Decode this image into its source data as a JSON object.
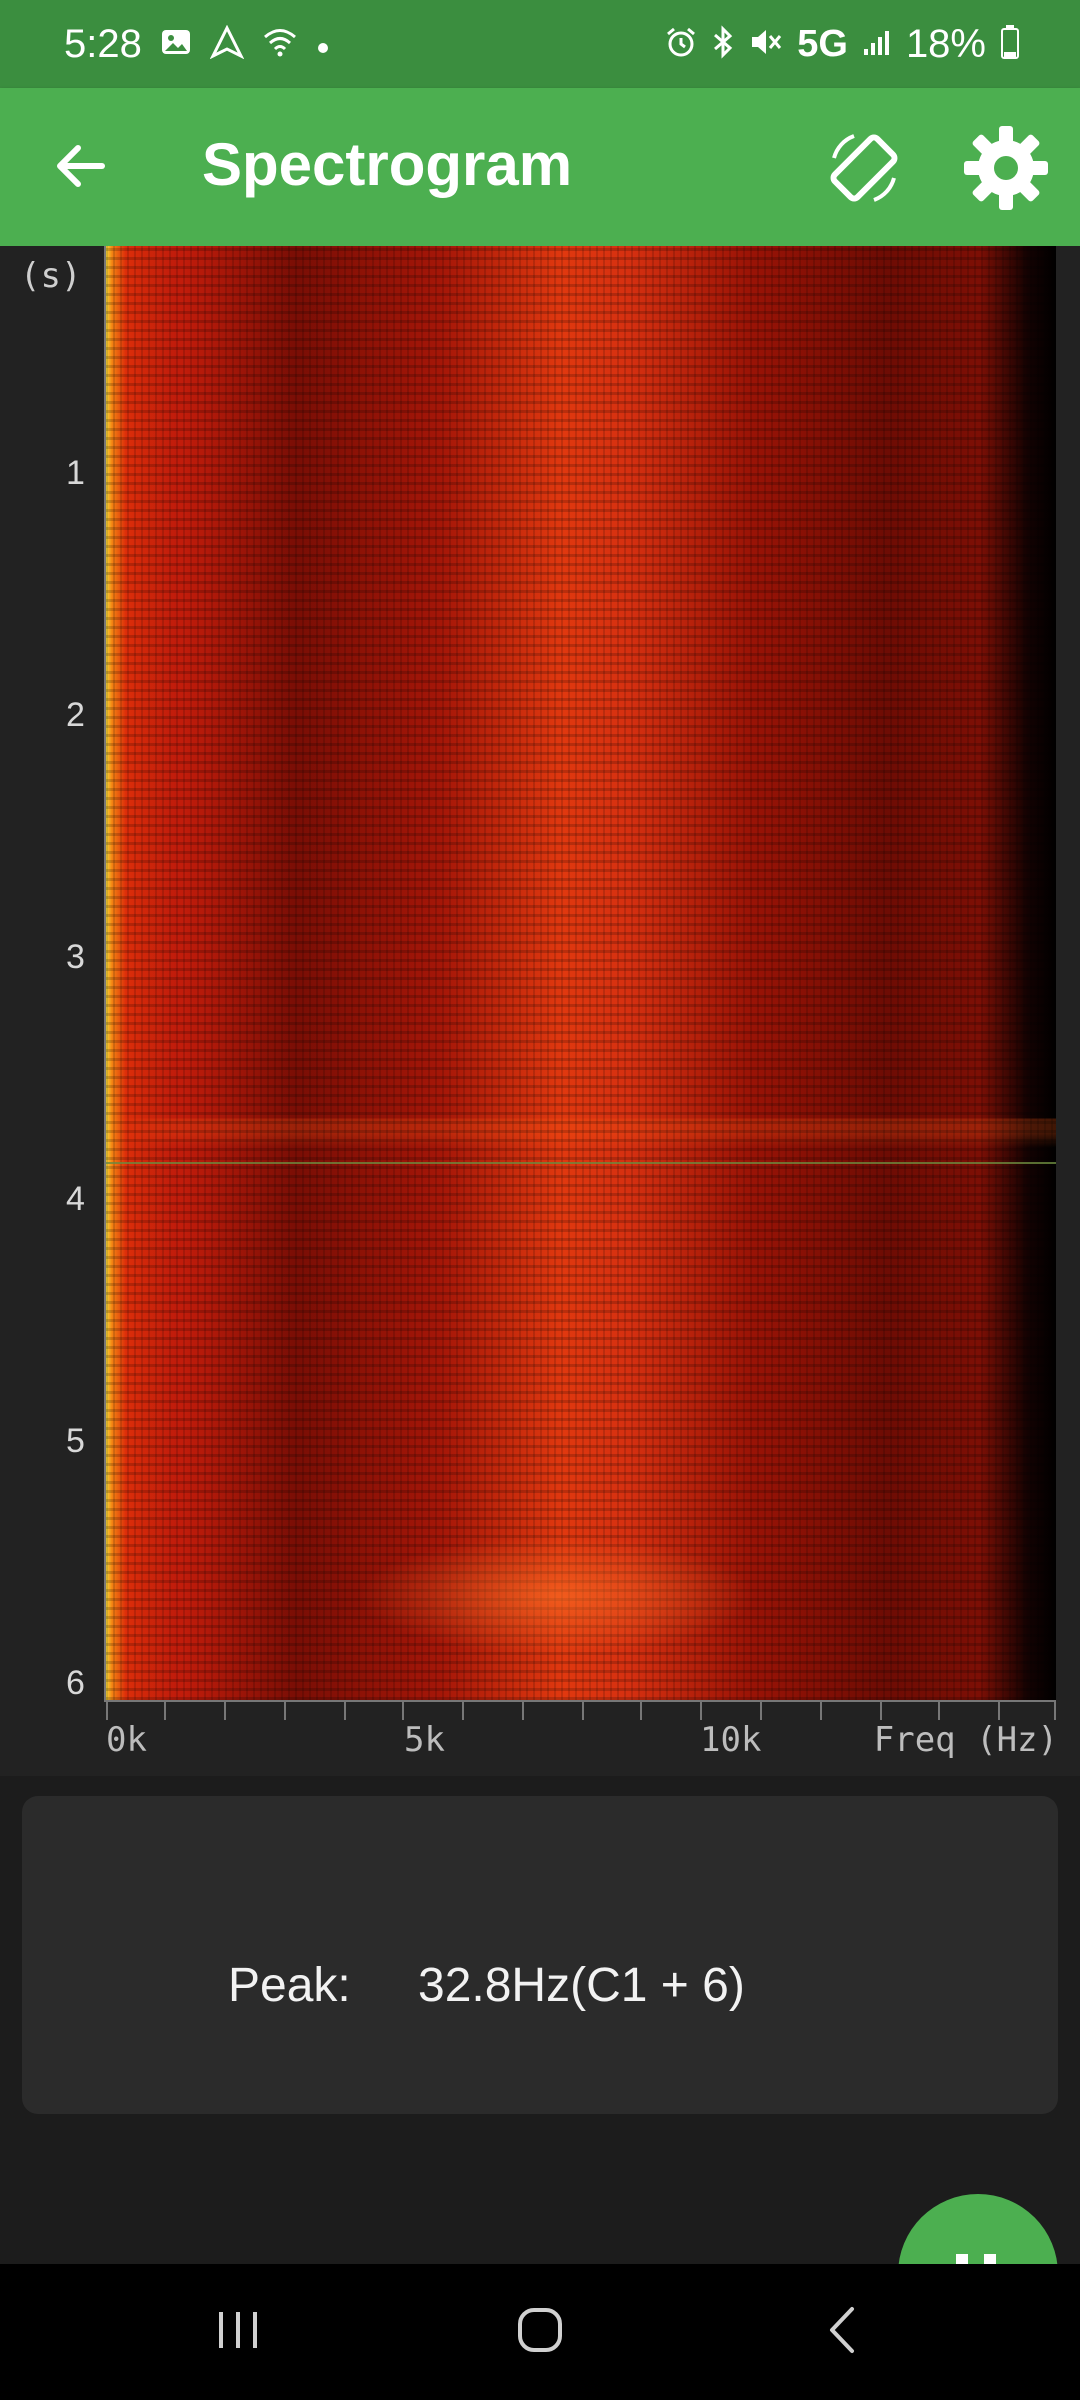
{
  "status_bar": {
    "time": "5:28",
    "network": "5G",
    "battery": "18%",
    "icons": [
      "image-icon",
      "navigation-icon",
      "wifi-icon",
      "dot-icon",
      "alarm-icon",
      "bluetooth-icon",
      "mute-icon",
      "signal-icon",
      "battery-icon"
    ]
  },
  "app_bar": {
    "title": "Spectrogram",
    "icons": [
      "back-arrow-icon",
      "screen-rotate-icon",
      "settings-gear-icon"
    ]
  },
  "spectrogram": {
    "y_unit": "(s)",
    "y_ticks": [
      "1",
      "2",
      "3",
      "4",
      "5",
      "6"
    ],
    "x_ticks": [
      "0k",
      "5k",
      "10k"
    ],
    "x_unit": "Freq (Hz)",
    "colormap": [
      "#000000",
      "#7a0e05",
      "#d63010",
      "#ff9614",
      "#ffe63c"
    ]
  },
  "peak": {
    "label": "Peak:",
    "value": "32.8Hz(C1 + 6)"
  },
  "fab": {
    "icon": "pause-icon"
  },
  "nav_bar": {
    "icons": [
      "recents-icon",
      "home-icon",
      "back-icon"
    ]
  },
  "colors": {
    "app_bar": "#4caf50",
    "status_bar": "#3b8e3f",
    "background": "#1c1c1c"
  }
}
